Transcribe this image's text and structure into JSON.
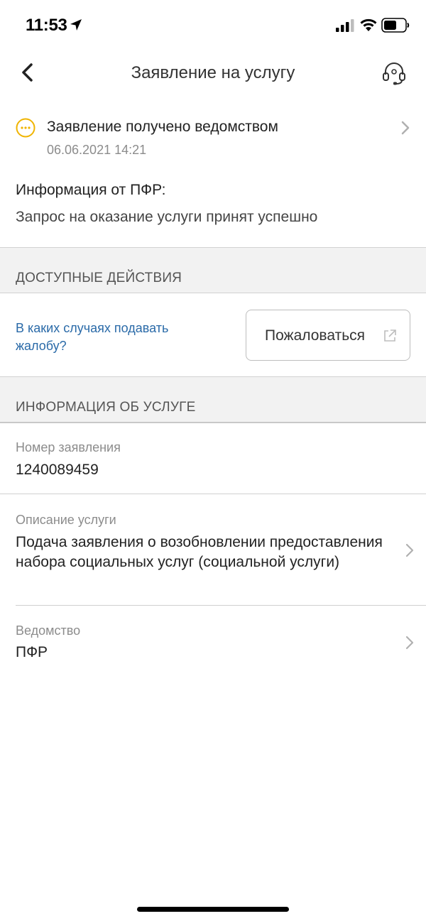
{
  "status_bar": {
    "time": "11:53"
  },
  "nav": {
    "title": "Заявление на услугу"
  },
  "status": {
    "text": "Заявление получено ведомством",
    "date": "06.06.2021 14:21",
    "icon_color": "#f0b400"
  },
  "info": {
    "heading": "Информация от ПФР:",
    "text": "Запрос на оказание услуги принят успешно"
  },
  "actions": {
    "section_title": "ДОСТУПНЫЕ ДЕЙСТВИЯ",
    "link_label": "В каких случаях подавать жалобу?",
    "complaint_button_label": "Пожаловаться"
  },
  "service_info": {
    "section_title": "ИНФОРМАЦИЯ ОБ УСЛУГЕ",
    "number_label": "Номер заявления",
    "number_value": "1240089459",
    "description_label": "Описание услуги",
    "description_value": "Подача заявления о возобновлении предоставления набора социальных услуг (социальной услуги)",
    "agency_label": "Ведомство",
    "agency_value": "ПФР"
  },
  "colors": {
    "link": "#2a6aa8",
    "section_bg": "#f2f2f2"
  },
  "icons": [
    "location-arrow-icon",
    "signal-icon",
    "wifi-icon",
    "battery-icon",
    "chevron-left-icon",
    "headset-icon",
    "status-pending-icon",
    "chevron-right-icon",
    "external-link-icon"
  ]
}
